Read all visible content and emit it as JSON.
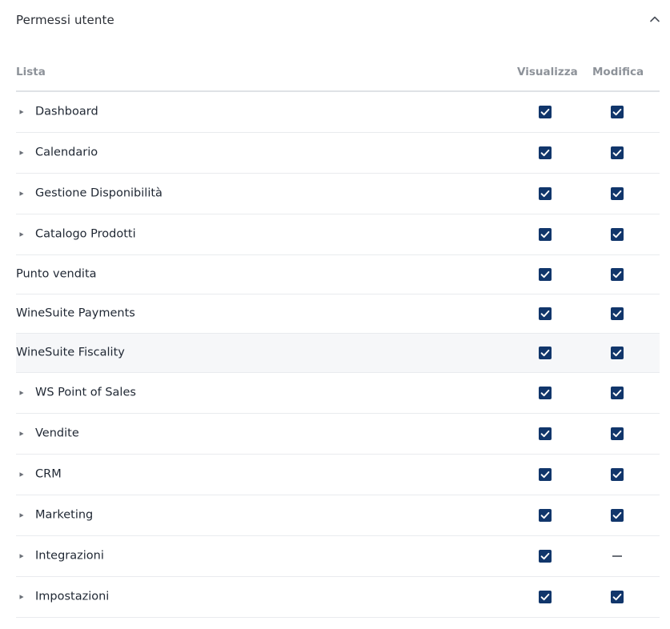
{
  "panel": {
    "title": "Permessi utente"
  },
  "table": {
    "headers": {
      "list": "Lista",
      "view": "Visualizza",
      "edit": "Modifica"
    },
    "rows": [
      {
        "label": "Dashboard",
        "expandable": true,
        "view": "checked",
        "edit": "checked",
        "highlighted": false
      },
      {
        "label": "Calendario",
        "expandable": true,
        "view": "checked",
        "edit": "checked",
        "highlighted": false
      },
      {
        "label": "Gestione Disponibilità",
        "expandable": true,
        "view": "checked",
        "edit": "checked",
        "highlighted": false
      },
      {
        "label": "Catalogo Prodotti",
        "expandable": true,
        "view": "checked",
        "edit": "checked",
        "highlighted": false
      },
      {
        "label": "Punto vendita",
        "expandable": false,
        "view": "checked",
        "edit": "checked",
        "highlighted": false
      },
      {
        "label": "WineSuite Payments",
        "expandable": false,
        "view": "checked",
        "edit": "checked",
        "highlighted": false
      },
      {
        "label": "WineSuite Fiscality",
        "expandable": false,
        "view": "checked",
        "edit": "checked",
        "highlighted": true
      },
      {
        "label": "WS Point of Sales",
        "expandable": true,
        "view": "checked",
        "edit": "checked",
        "highlighted": false
      },
      {
        "label": "Vendite",
        "expandable": true,
        "view": "checked",
        "edit": "checked",
        "highlighted": false
      },
      {
        "label": "CRM",
        "expandable": true,
        "view": "checked",
        "edit": "checked",
        "highlighted": false
      },
      {
        "label": "Marketing",
        "expandable": true,
        "view": "checked",
        "edit": "checked",
        "highlighted": false
      },
      {
        "label": "Integrazioni",
        "expandable": true,
        "view": "checked",
        "edit": "none",
        "highlighted": false
      },
      {
        "label": "Impostazioni",
        "expandable": true,
        "view": "checked",
        "edit": "checked",
        "highlighted": false
      }
    ]
  },
  "colors": {
    "checkbox": "#11366b",
    "header_text": "#8d9299",
    "divider": "#e9ebee",
    "highlight_row": "#f6f7f9"
  },
  "icons": {
    "collapse": "chevron-up-icon",
    "expand": "triangle-right-icon",
    "check": "checkmark-icon",
    "none": "dash-icon"
  }
}
